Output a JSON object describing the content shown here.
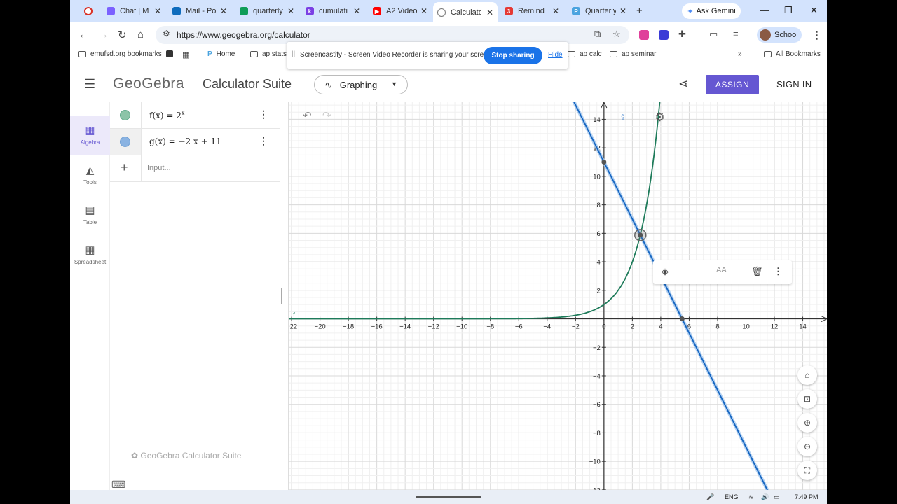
{
  "browser": {
    "tabs": [
      {
        "title": "",
        "favicon_color": "#d93025"
      },
      {
        "title": "Chat | M",
        "favicon_color": "#7b61ff"
      },
      {
        "title": "Mail - Po",
        "favicon_color": "#0f6cbd"
      },
      {
        "title": "quarterly",
        "favicon_color": "#0f9d58"
      },
      {
        "title": "cumulati",
        "favicon_color": "#7b3fe4"
      },
      {
        "title": "A2 Video",
        "favicon_color": "#ff0000"
      },
      {
        "title": "Calculato",
        "favicon_color": "#777777",
        "active": true
      },
      {
        "title": "Remind",
        "favicon_color": "#e53935"
      },
      {
        "title": "Quarterly",
        "favicon_color": "#4aa3df"
      }
    ],
    "new_tab": "+",
    "gemini": "Ask Gemini",
    "url": "https://www.geogebra.org/calculator",
    "profile": "School",
    "bookmarks": [
      {
        "label": "emufsd.org bookmarks"
      },
      {
        "label": ""
      },
      {
        "label": ""
      },
      {
        "label": "Home"
      },
      {
        "label": "ap stats"
      },
      {
        "label": "ap calc"
      },
      {
        "label": "ap seminar"
      }
    ],
    "all_bookmarks": "All Bookmarks",
    "sharing": {
      "message": "Screencastify - Screen Video Recorder is sharing your screen.",
      "stop": "Stop sharing",
      "hide": "Hide"
    }
  },
  "app": {
    "logo": "GeoGebra",
    "suite": "Calculator Suite",
    "mode": "Graphing",
    "assign": "ASSIGN",
    "signin": "SIGN IN",
    "rail": [
      {
        "label": "Algebra",
        "icon": "calculator-icon",
        "active": true
      },
      {
        "label": "Tools",
        "icon": "tools-icon"
      },
      {
        "label": "Table",
        "icon": "table-icon"
      },
      {
        "label": "Spreadsheet",
        "icon": "spreadsheet-icon"
      }
    ],
    "algebra": [
      {
        "lhs": "f(x)  =  2",
        "sup": "x",
        "color": "#5fa98a"
      },
      {
        "lhs": "g(x)  =  −2 x + 11",
        "sup": "",
        "color": "#6f9fd3"
      }
    ],
    "input_placeholder": "Input...",
    "watermark": "GeoGebra Calculator Suite"
  },
  "chart_data": {
    "type": "line",
    "series": [
      {
        "name": "f",
        "expression": "2^x",
        "color": "#1e7b5a"
      },
      {
        "name": "g",
        "expression": "-2x+11",
        "color": "#1565c0"
      }
    ],
    "x_ticks": [
      -22,
      -20,
      -18,
      -16,
      -14,
      -12,
      -10,
      -8,
      -6,
      -4,
      -2,
      0,
      2,
      4,
      6,
      8,
      10,
      12,
      14
    ],
    "y_ticks": [
      14,
      12,
      10,
      8,
      6,
      4,
      2,
      -2,
      -4,
      -6,
      -8,
      -10,
      -12
    ],
    "xlim": [
      -22.2,
      15.7
    ],
    "ylim": [
      -12.3,
      15.2
    ],
    "points": [
      {
        "x": 0,
        "y": 11
      },
      {
        "x": 5.5,
        "y": 0
      },
      {
        "x": 2.562,
        "y": 5.877,
        "selected": true
      }
    ],
    "grid": true
  },
  "taskbar": {
    "lang": "ENG",
    "time": "7:49 PM"
  }
}
